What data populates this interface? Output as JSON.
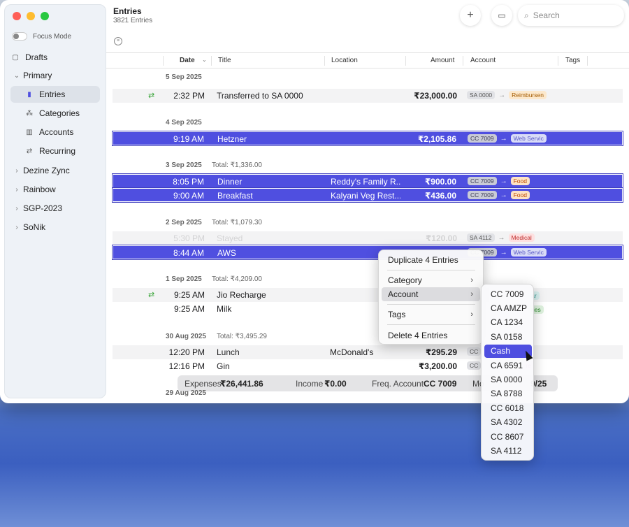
{
  "window": {
    "title": "Entries",
    "subtitle": "3821 Entries"
  },
  "sidebar": {
    "focus_mode_label": "Focus Mode",
    "drafts_label": "Drafts",
    "primary_label": "Primary",
    "primary_children": [
      {
        "label": "Entries",
        "icon": "book-icon",
        "active": true
      },
      {
        "label": "Categories",
        "icon": "categories-icon"
      },
      {
        "label": "Accounts",
        "icon": "bank-icon"
      },
      {
        "label": "Recurring",
        "icon": "repeat-icon"
      }
    ],
    "groups": [
      "Dezine Zync",
      "Rainbow",
      "SGP-2023",
      "SoNik"
    ]
  },
  "toolbar": {
    "add_icon": "plus-icon",
    "calendar_icon": "calendar-icon",
    "search_placeholder": "Search"
  },
  "table": {
    "columns": [
      "Date",
      "Title",
      "Location",
      "Amount",
      "Account",
      "Tags"
    ]
  },
  "groups": [
    {
      "date": "5 Sep 2025",
      "total": "",
      "rows": [
        {
          "time": "2:32 PM",
          "title": "Transferred to SA 0000",
          "location": "",
          "amount": "₹23,000.00",
          "from": "SA 0000",
          "to": "Reimbursen",
          "to_style": "reimb",
          "sync": true,
          "selected": false,
          "alt": true
        }
      ]
    },
    {
      "date": "4 Sep 2025",
      "total": "",
      "rows": [
        {
          "time": "9:19 AM",
          "title": "Hetzner",
          "location": "",
          "amount": "₹2,105.86",
          "from": "CC 7009",
          "to": "Web Servic",
          "to_style": "web",
          "selected": true
        }
      ]
    },
    {
      "date": "3 Sep 2025",
      "total": "Total: ₹1,336.00",
      "rows": [
        {
          "time": "8:05 PM",
          "title": "Dinner",
          "location": "Reddy's Family R...",
          "amount": "₹900.00",
          "from": "CC 7009",
          "to": "Food",
          "to_style": "food",
          "selected": true
        },
        {
          "time": "9:00 AM",
          "title": "Breakfast",
          "location": "Kalyani Veg Rest...",
          "amount": "₹436.00",
          "from": "CC 7009",
          "to": "Food",
          "to_style": "food",
          "selected": true
        }
      ]
    },
    {
      "date": "2 Sep 2025",
      "total": "Total: ₹1,079.30",
      "rows": [
        {
          "time": "5:30 PM",
          "title": "Stayed",
          "location": "",
          "amount": "₹120.00",
          "from": "SA 4112",
          "to": "Medical",
          "to_style": "med",
          "selected": false,
          "faded": true
        },
        {
          "time": "8:44 AM",
          "title": "AWS",
          "location": "",
          "amount": "",
          "from": "CC 7009",
          "to": "Web Servic",
          "to_style": "web",
          "selected": true
        }
      ]
    },
    {
      "date": "1 Sep 2025",
      "total": "Total: ₹4,209.00",
      "rows": [
        {
          "time": "9:25 AM",
          "title": "Jio Recharge",
          "location": "",
          "amount": "",
          "from": "",
          "to": "ar",
          "to_style": "web",
          "sync": true,
          "alt": true
        },
        {
          "time": "9:25 AM",
          "title": "Milk",
          "location": "",
          "amount": "",
          "from": "",
          "to": "ries",
          "to_style": "web"
        }
      ]
    },
    {
      "date": "30 Aug 2025",
      "total": "Total: ₹3,495.29",
      "rows": [
        {
          "time": "12:20 PM",
          "title": "Lunch",
          "location": "McDonald's",
          "amount": "₹295.29",
          "from": "CC",
          "to": "",
          "to_style": "",
          "alt": true
        },
        {
          "time": "12:16 PM",
          "title": "Gin",
          "location": "",
          "amount": "₹3,200.00",
          "from": "CC",
          "to": "re",
          "to_style": "med"
        }
      ]
    }
  ],
  "footer": {
    "expenses_label": "Expenses",
    "expenses_value": "₹26,441.86",
    "income_label": "Income",
    "income_value": "₹0.00",
    "freq_label": "Freq. Account",
    "freq_value": "CC 7009",
    "tail_label": "Mo",
    "tail_value": "9/25"
  },
  "peek_date": "29 Aug 2025",
  "context_menu": {
    "duplicate": "Duplicate 4 Entries",
    "category": "Category",
    "account": "Account",
    "tags": "Tags",
    "delete": "Delete 4 Entries"
  },
  "account_submenu": [
    "CC 7009",
    "CA AMZP",
    "CA 1234",
    "SA 0158",
    "Cash",
    "CA 6591",
    "SA 0000",
    "SA 8788",
    "CC 6018",
    "SA 4302",
    "CC 8607",
    "SA 4112"
  ],
  "account_submenu_selected": "Cash"
}
